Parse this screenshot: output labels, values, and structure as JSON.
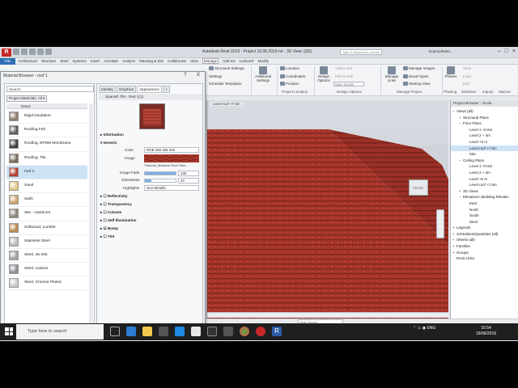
{
  "app": {
    "title": "Autodesk Revit 2019 - Project 16.06.2019.rvt - 3D View: {3D}",
    "search_placeholder": "Type a keyword or phrase",
    "user": "bcanny/5494..."
  },
  "menu": {
    "file": "File",
    "tabs": [
      "Architecture",
      "Structure",
      "Steel",
      "Systems",
      "Insert",
      "Annotate",
      "Analyze",
      "Massing & Site",
      "Collaborate",
      "View",
      "Manage",
      "Add-Ins",
      "Lumion®",
      "Modify"
    ],
    "active_tab": "Manage"
  },
  "ribbon": {
    "buttons": {
      "object_styles": "Object Styles",
      "project_parameters": "Project Parameters",
      "transfer": "Transfer Project Standards",
      "structural_settings": "Structural Settings",
      "settings": "Settings",
      "schedule_templates": "Schedule Templates",
      "additional_settings": "Additional Settings",
      "location": "Location",
      "coordinates": "Coordinates",
      "position": "Position",
      "design_options": "Design Options",
      "add_to_set": "Add to Set",
      "pick_to_edit": "Pick to Edit",
      "main_model": "Main Model",
      "manage_links": "Manage Links",
      "manage_images": "Manage Images",
      "decal_types": "Decal Types",
      "starting_view": "Starting View",
      "phases": "Phases",
      "save": "Save",
      "load": "Load",
      "edit": "Edit",
      "selection": "Selection",
      "inquiry": "Inquiry",
      "macros": "Macros"
    },
    "groups": {
      "project_location": "Project Location",
      "design_options": "Design Options",
      "manage_project": "Manage Project",
      "phasing": "Phasing",
      "selection": "Selection",
      "inquiry": "Inquiry",
      "macros": "Macros"
    }
  },
  "view": {
    "tab_label": "Level roof +7.5m",
    "cube_label": "FRONT"
  },
  "material_browser": {
    "title": "Material Browser - roof 1",
    "help": "?",
    "close": "X",
    "search_value": "Search",
    "filter_label": "Project Materials: All",
    "column_name": "Name",
    "materials": [
      {
        "name": "Rigid insulation",
        "color": "#8a7a6a"
      },
      {
        "name": "Roofing Felt",
        "color": "#5a5a5a"
      },
      {
        "name": "Roofing, EPDM Membrane",
        "color": "#3a3a3a"
      },
      {
        "name": "Roofing, Tile",
        "color": "#7a6a5a"
      },
      {
        "name": "roof 1",
        "color": "#b03a2e"
      },
      {
        "name": "Sand",
        "color": "#e3c98a"
      },
      {
        "name": "Sash",
        "color": "#c9a36b"
      },
      {
        "name": "Site - Hardcore",
        "color": "#8d8377"
      },
      {
        "name": "Softwood, Lumber",
        "color": "#b78a4f"
      },
      {
        "name": "Stainless Steel",
        "color": "#b9bcc0"
      },
      {
        "name": "Steel, 45-345",
        "color": "#9ea2a7"
      },
      {
        "name": "Steel, Carbon",
        "color": "#8a8f95"
      },
      {
        "name": "Steel, Chrome Plated",
        "color": "#c8cbcf"
      }
    ],
    "selected_index": 4,
    "tabs": [
      "Identity",
      "Graphics",
      "Appearance",
      "+"
    ],
    "active_tab": "Appearance",
    "asset_name": "Spanish Tile - Red 1(1)",
    "sections": {
      "information": "Information",
      "generic": "Generic",
      "reflectivity": "Reflectivity",
      "transparency": "Transparency",
      "cutouts": "Cutouts",
      "self_illumination": "Self Illumination",
      "bump": "Bump",
      "tint": "Tint"
    },
    "props": {
      "color_label": "Color",
      "color_value": "RGB 255 255 255",
      "image_label": "Image",
      "image_file": "Thermal_Moisture.Roof.Tiles...",
      "image_fade_label": "Image Fade",
      "image_fade_value": "100",
      "glossiness_label": "Glossiness",
      "glossiness_value": "20",
      "highlights_label": "Highlights",
      "highlights_value": "Non-Metallic"
    },
    "buttons": {
      "ok": "OK",
      "cancel": "Cancel",
      "apply": "Apply"
    }
  },
  "project_browser": {
    "title": "Project Browser - 16.06...",
    "items": [
      {
        "label": "Views (all)",
        "indent": 0,
        "sign": "−"
      },
      {
        "label": "Structural Plans",
        "indent": 1,
        "sign": "+"
      },
      {
        "label": "Floor Plans",
        "indent": 1,
        "sign": "−"
      },
      {
        "label": "Level 1 +0.5m",
        "indent": 2,
        "sign": ""
      },
      {
        "label": "Level 2 + 4m",
        "indent": 2,
        "sign": ""
      },
      {
        "label": "Level +0 m",
        "indent": 2,
        "sign": ""
      },
      {
        "label": "Level roof +7.5m",
        "indent": 2,
        "sign": "",
        "selected": true
      },
      {
        "label": "Site",
        "indent": 2,
        "sign": ""
      },
      {
        "label": "Ceiling Plans",
        "indent": 1,
        "sign": "−"
      },
      {
        "label": "Level 1 +0.5m",
        "indent": 2,
        "sign": ""
      },
      {
        "label": "Level 2 + 4m",
        "indent": 2,
        "sign": ""
      },
      {
        "label": "Level +0 m",
        "indent": 2,
        "sign": ""
      },
      {
        "label": "Level roof +7.5m",
        "indent": 2,
        "sign": ""
      },
      {
        "label": "3D Views",
        "indent": 1,
        "sign": "+"
      },
      {
        "label": "Elevations (Building Elevatio",
        "indent": 1,
        "sign": "−"
      },
      {
        "label": "East",
        "indent": 2,
        "sign": ""
      },
      {
        "label": "North",
        "indent": 2,
        "sign": ""
      },
      {
        "label": "South",
        "indent": 2,
        "sign": ""
      },
      {
        "label": "West",
        "indent": 2,
        "sign": ""
      },
      {
        "label": "Legends",
        "indent": 0,
        "sign": "+"
      },
      {
        "label": "Schedules/Quantities (all)",
        "indent": 0,
        "sign": "+"
      },
      {
        "label": "Sheets (all)",
        "indent": 0,
        "sign": "+"
      },
      {
        "label": "Families",
        "indent": 0,
        "sign": "+"
      },
      {
        "label": "Groups",
        "indent": 0,
        "sign": "+"
      },
      {
        "label": "Revit Links",
        "indent": 0,
        "sign": ""
      }
    ]
  },
  "status": {
    "ready": "Ready",
    "main_model": "Main Model"
  },
  "taskbar": {
    "search_placeholder": "Type here to search",
    "lang": "ENG",
    "time": "16:54",
    "date": "16/06/2019"
  }
}
